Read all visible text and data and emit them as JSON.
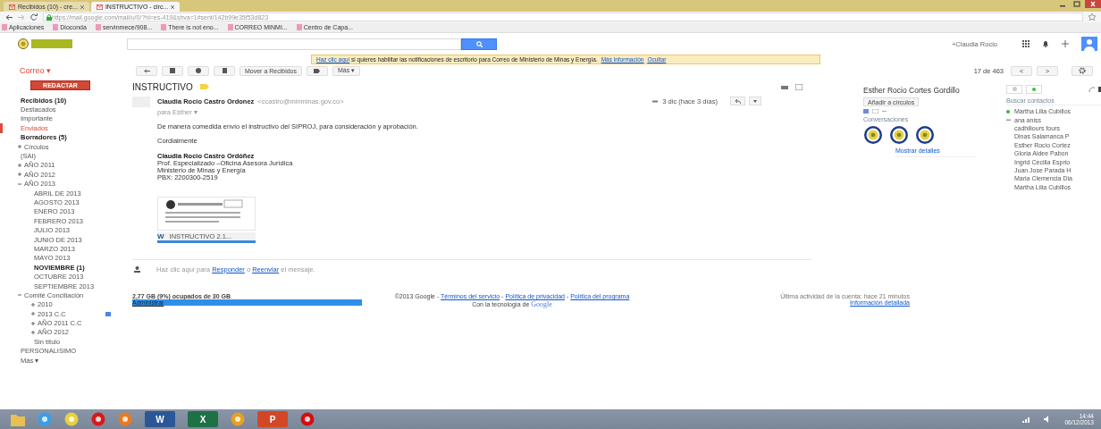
{
  "browser": {
    "tabs": [
      {
        "label": "Recibidos (10) - cre...",
        "selected": false
      },
      {
        "label": "INSTRUCTIVO - circ...",
        "selected": true
      }
    ],
    "url": "https://mail.google.com/mail/u/0/?hl=es-419&shva=1#sent/142b99e35f53d823",
    "bookmarks": [
      "Aplicaciones",
      "Dioconda",
      "servinmece/908...",
      "There is not eno...",
      "CORREO MINMI...",
      "Centro de Capa..."
    ]
  },
  "header": {
    "account": "+Claudia Rocio"
  },
  "banner": {
    "link": "Haz clic aquí",
    "text": "si quieres habilitar las notificaciones de escritorio para Correo de Ministerio de Minas y Energía.",
    "more": "Más información",
    "hide": "Ocultar"
  },
  "toolbar": {
    "app_menu": "Correo ▾",
    "move": "Mover a Recibidos",
    "more": "Más ▾",
    "count": "17 de 463",
    "prev": "<",
    "next": ">"
  },
  "sidebar": {
    "compose": "REDACTAR",
    "items": [
      {
        "label": "Recibidos (10)",
        "unread": true,
        "selected": false
      },
      {
        "label": "Destacados",
        "unread": false,
        "selected": false
      },
      {
        "label": "Importante",
        "unread": false,
        "selected": false
      },
      {
        "label": "Enviados",
        "unread": false,
        "selected": true
      },
      {
        "label": "Borradores (5)",
        "unread": true,
        "selected": false
      },
      {
        "label": "Círculos",
        "unread": false,
        "selected": false,
        "expanded": false
      },
      {
        "label": "(SAI)",
        "unread": false,
        "selected": false
      },
      {
        "label": "AÑO 2011",
        "unread": false,
        "selected": false,
        "expanded": false
      },
      {
        "label": "AÑO 2012",
        "unread": false,
        "selected": false,
        "expanded": false
      },
      {
        "label": "AÑO 2013",
        "unread": false,
        "selected": false,
        "expanded": true,
        "children": [
          {
            "label": "ABRIL DE 2013",
            "unread": false,
            "selected": false
          },
          {
            "label": "AGOSTO 2013",
            "unread": false,
            "selected": false
          },
          {
            "label": "ENERO 2013",
            "unread": false,
            "selected": false
          },
          {
            "label": "FEBRERO 2013",
            "unread": false,
            "selected": false
          },
          {
            "label": "JULIO 2013",
            "unread": false,
            "selected": false
          },
          {
            "label": "JUNIO DE 2013",
            "unread": false,
            "selected": false
          },
          {
            "label": "MARZO 2013",
            "unread": false,
            "selected": false
          },
          {
            "label": "MAYO 2013",
            "unread": false,
            "selected": false
          },
          {
            "label": "NOVIEMBRE (1)",
            "unread": true,
            "selected": false
          },
          {
            "label": "OCTUBRE 2013",
            "unread": false,
            "selected": false
          },
          {
            "label": "SEPTIEMBRE 2013",
            "unread": false,
            "selected": false
          }
        ]
      },
      {
        "label": "Comité Conciliación",
        "unread": false,
        "selected": false,
        "expanded": true,
        "children": [
          {
            "label": "2010",
            "unread": false,
            "selected": false,
            "expanded": false
          },
          {
            "label": "2013 C.C",
            "unread": false,
            "selected": false,
            "expanded": false,
            "color": "#4a86e8"
          },
          {
            "label": "AÑO 2011 C.C",
            "unread": false,
            "selected": false,
            "expanded": false
          },
          {
            "label": "AÑO 2012",
            "unread": false,
            "selected": false,
            "expanded": false
          },
          {
            "label": "Sin título",
            "unread": false,
            "selected": false
          }
        ]
      },
      {
        "label": "PERSONALISIMO",
        "unread": false,
        "selected": false
      },
      {
        "label": "Más ▾",
        "unread": false,
        "selected": false
      }
    ]
  },
  "message": {
    "subject": "INSTRUCTIVO",
    "sender": "Claudia Rocio Castro Ordonez",
    "email": "<ccastro@minminas.gov.co>",
    "to": "para Esther ▾",
    "date": "3 dic (hace 3 días)",
    "body": "De manera comedida envío el instructivo del SIPROJ, para consideración y aprobación.",
    "closing": "Cordialmente",
    "signature": [
      "Claudia Rocio Castro Ordóñez",
      "Prof. Especializado –Oficina Asesora Jurídica",
      "Ministerio de Minas y Energía",
      "PBX: 2200300-2519"
    ],
    "attachment": {
      "letter": "W",
      "name": "INSTRUCTIVO 2.1..."
    },
    "reply_prompt": {
      "before": "Haz clic aquí para",
      "reply": "Responder",
      "middle": "o",
      "forward": "Reenviar",
      "after": "el mensaje."
    }
  },
  "storage": {
    "usage": "2,77 GB (9%) ocupados de 30 GB",
    "manage": "Administrar"
  },
  "footer": {
    "copyright": "©2013 Google -",
    "separator": "-",
    "links": [
      "Términos del servicio",
      "Política de privacidad",
      "Política del programa"
    ],
    "powered": "Con la tecnología de",
    "brand": "Google"
  },
  "activity": {
    "text": "Última actividad de la cuenta: hace 21 minutos",
    "details": "Información detallada"
  },
  "profile": {
    "name": "Esther Rocio Cortes Gordillo",
    "add": "Añadir a círculos",
    "section": "Conversaciones",
    "details": "Mostrar detalles"
  },
  "chat": {
    "placeholder": "Buscar contactos",
    "contacts": [
      {
        "name": "Martha Lilia Cubillos",
        "kind": "online"
      },
      {
        "name": "ana aniss",
        "kind": "mobile"
      },
      {
        "name": "cadhiliours fours",
        "kind": "plain"
      },
      {
        "name": "Dinas Salamanca P",
        "kind": "plain"
      },
      {
        "name": "Esther Rocio Cortez",
        "kind": "plain"
      },
      {
        "name": "Gloria Aidee Pabon",
        "kind": "plain"
      },
      {
        "name": "Ingrid Cecilia Esprio",
        "kind": "plain"
      },
      {
        "name": "Juan Jose Parada H",
        "kind": "plain"
      },
      {
        "name": "Maria Clemencia Dia",
        "kind": "plain"
      },
      {
        "name": "Martha Lilia Cubillos",
        "kind": "plain"
      }
    ]
  },
  "taskbar": {
    "apps": [
      {
        "kind": "folder"
      },
      {
        "kind": "ie"
      },
      {
        "kind": "chrome"
      },
      {
        "kind": "opera"
      },
      {
        "kind": "firefox"
      },
      {
        "kind": "word",
        "label": "W"
      },
      {
        "kind": "excel",
        "label": "X"
      },
      {
        "kind": "other"
      },
      {
        "kind": "powerpoint",
        "label": "P"
      },
      {
        "kind": "acrobat"
      }
    ],
    "time": "14:44",
    "date": "06/12/2013"
  }
}
